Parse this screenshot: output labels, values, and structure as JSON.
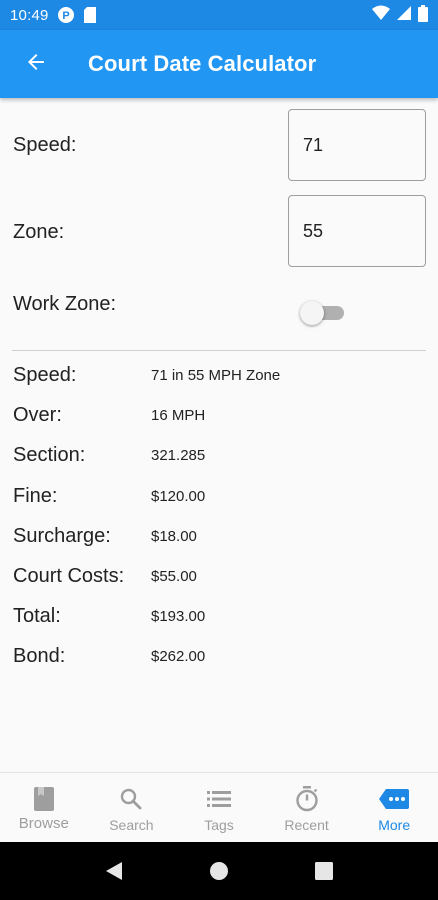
{
  "status_bar": {
    "time": "10:49"
  },
  "app_bar": {
    "title": "Court Date Calculator"
  },
  "form": {
    "speed_label": "Speed:",
    "speed_value": "71",
    "zone_label": "Zone:",
    "zone_value": "55",
    "work_zone_label": "Work Zone:",
    "work_zone_on": false
  },
  "results": [
    {
      "label": "Speed:",
      "value": "71 in 55 MPH  Zone"
    },
    {
      "label": "Over:",
      "value": "16 MPH"
    },
    {
      "label": "Section:",
      "value": "321.285"
    },
    {
      "label": "Fine:",
      "value": "$120.00"
    },
    {
      "label": "Surcharge:",
      "value": "$18.00"
    },
    {
      "label": "Court Costs:",
      "value": "$55.00"
    },
    {
      "label": "Total:",
      "value": "$193.00"
    },
    {
      "label": "Bond:",
      "value": "$262.00"
    }
  ],
  "bottom_nav": {
    "items": [
      {
        "label": "Browse",
        "icon": "book-icon"
      },
      {
        "label": "Search",
        "icon": "search-icon"
      },
      {
        "label": "Tags",
        "icon": "list-icon"
      },
      {
        "label": "Recent",
        "icon": "timer-icon"
      },
      {
        "label": "More",
        "icon": "more-icon"
      }
    ],
    "active": "More"
  },
  "colors": {
    "primary": "#2196f3",
    "status_bar": "#1e88e5",
    "active_nav": "#1e88e5",
    "inactive_nav": "#9e9e9e"
  }
}
